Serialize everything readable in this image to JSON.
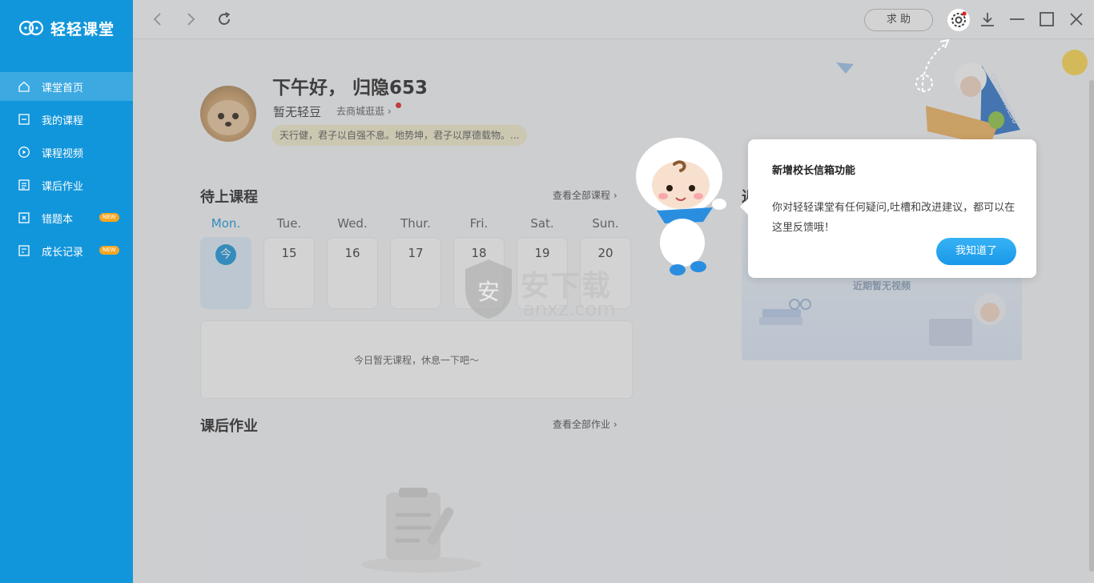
{
  "app": {
    "name": "轻轻课堂"
  },
  "sidebar": {
    "items": [
      {
        "label": "课堂首页",
        "icon": "home-icon",
        "active": true
      },
      {
        "label": "我的课程",
        "icon": "course-icon"
      },
      {
        "label": "课程视频",
        "icon": "play-icon"
      },
      {
        "label": "课后作业",
        "icon": "homework-icon"
      },
      {
        "label": "错题本",
        "icon": "mistake-book-icon",
        "badge": "NEW"
      },
      {
        "label": "成长记录",
        "icon": "growth-record-icon",
        "badge": "NEW"
      }
    ]
  },
  "toolbar": {
    "help_label": "求 助"
  },
  "profile": {
    "greeting": "下午好， 归隐653",
    "nickname": "暂无轻豆",
    "shop_link": "去商城逛逛",
    "motto": "天行健，君子以自强不息。地势坤，君子以厚德载物。..."
  },
  "upcoming": {
    "title": "待上课程",
    "see_all": "查看全部课程",
    "days": [
      {
        "name": "Mon.",
        "date": "今",
        "current": true
      },
      {
        "name": "Tue.",
        "date": "15"
      },
      {
        "name": "Wed.",
        "date": "16"
      },
      {
        "name": "Thur.",
        "date": "17"
      },
      {
        "name": "Fri.",
        "date": "18"
      },
      {
        "name": "Sat.",
        "date": "19"
      },
      {
        "name": "Sun.",
        "date": "20"
      }
    ],
    "empty": "今日暂无课程，休息一下吧～"
  },
  "recent_video": {
    "title_fragment": "近",
    "empty": "近期暂无视频"
  },
  "homework": {
    "title": "课后作业",
    "see_all": "查看全部作业"
  },
  "banner": {
    "flag_text": "CHANGINGEDU"
  },
  "popup": {
    "title": "新增校长信箱功能",
    "body": "你对轻轻课堂有任何疑问,吐槽和改进建议，都可以在这里反馈哦！",
    "ok": "我知道了"
  },
  "watermark": {
    "glyph": "安",
    "text": "安下载",
    "domain": "anxz.com"
  },
  "colors": {
    "sidebar": "#1296db",
    "accent": "#1296db",
    "badge": "#f5a623",
    "notify_dot": "#e02020"
  }
}
